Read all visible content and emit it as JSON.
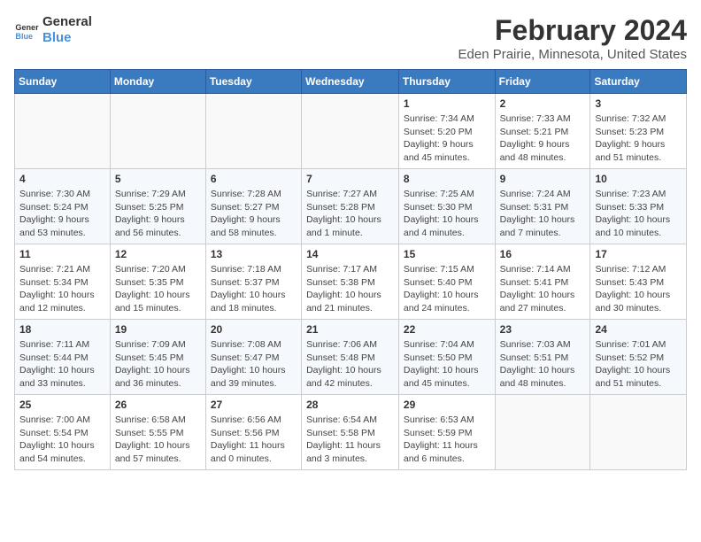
{
  "header": {
    "logo_line1": "General",
    "logo_line2": "Blue",
    "month_title": "February 2024",
    "location": "Eden Prairie, Minnesota, United States"
  },
  "weekdays": [
    "Sunday",
    "Monday",
    "Tuesday",
    "Wednesday",
    "Thursday",
    "Friday",
    "Saturday"
  ],
  "weeks": [
    [
      {
        "day": "",
        "info": ""
      },
      {
        "day": "",
        "info": ""
      },
      {
        "day": "",
        "info": ""
      },
      {
        "day": "",
        "info": ""
      },
      {
        "day": "1",
        "info": "Sunrise: 7:34 AM\nSunset: 5:20 PM\nDaylight: 9 hours\nand 45 minutes."
      },
      {
        "day": "2",
        "info": "Sunrise: 7:33 AM\nSunset: 5:21 PM\nDaylight: 9 hours\nand 48 minutes."
      },
      {
        "day": "3",
        "info": "Sunrise: 7:32 AM\nSunset: 5:23 PM\nDaylight: 9 hours\nand 51 minutes."
      }
    ],
    [
      {
        "day": "4",
        "info": "Sunrise: 7:30 AM\nSunset: 5:24 PM\nDaylight: 9 hours\nand 53 minutes."
      },
      {
        "day": "5",
        "info": "Sunrise: 7:29 AM\nSunset: 5:25 PM\nDaylight: 9 hours\nand 56 minutes."
      },
      {
        "day": "6",
        "info": "Sunrise: 7:28 AM\nSunset: 5:27 PM\nDaylight: 9 hours\nand 58 minutes."
      },
      {
        "day": "7",
        "info": "Sunrise: 7:27 AM\nSunset: 5:28 PM\nDaylight: 10 hours\nand 1 minute."
      },
      {
        "day": "8",
        "info": "Sunrise: 7:25 AM\nSunset: 5:30 PM\nDaylight: 10 hours\nand 4 minutes."
      },
      {
        "day": "9",
        "info": "Sunrise: 7:24 AM\nSunset: 5:31 PM\nDaylight: 10 hours\nand 7 minutes."
      },
      {
        "day": "10",
        "info": "Sunrise: 7:23 AM\nSunset: 5:33 PM\nDaylight: 10 hours\nand 10 minutes."
      }
    ],
    [
      {
        "day": "11",
        "info": "Sunrise: 7:21 AM\nSunset: 5:34 PM\nDaylight: 10 hours\nand 12 minutes."
      },
      {
        "day": "12",
        "info": "Sunrise: 7:20 AM\nSunset: 5:35 PM\nDaylight: 10 hours\nand 15 minutes."
      },
      {
        "day": "13",
        "info": "Sunrise: 7:18 AM\nSunset: 5:37 PM\nDaylight: 10 hours\nand 18 minutes."
      },
      {
        "day": "14",
        "info": "Sunrise: 7:17 AM\nSunset: 5:38 PM\nDaylight: 10 hours\nand 21 minutes."
      },
      {
        "day": "15",
        "info": "Sunrise: 7:15 AM\nSunset: 5:40 PM\nDaylight: 10 hours\nand 24 minutes."
      },
      {
        "day": "16",
        "info": "Sunrise: 7:14 AM\nSunset: 5:41 PM\nDaylight: 10 hours\nand 27 minutes."
      },
      {
        "day": "17",
        "info": "Sunrise: 7:12 AM\nSunset: 5:43 PM\nDaylight: 10 hours\nand 30 minutes."
      }
    ],
    [
      {
        "day": "18",
        "info": "Sunrise: 7:11 AM\nSunset: 5:44 PM\nDaylight: 10 hours\nand 33 minutes."
      },
      {
        "day": "19",
        "info": "Sunrise: 7:09 AM\nSunset: 5:45 PM\nDaylight: 10 hours\nand 36 minutes."
      },
      {
        "day": "20",
        "info": "Sunrise: 7:08 AM\nSunset: 5:47 PM\nDaylight: 10 hours\nand 39 minutes."
      },
      {
        "day": "21",
        "info": "Sunrise: 7:06 AM\nSunset: 5:48 PM\nDaylight: 10 hours\nand 42 minutes."
      },
      {
        "day": "22",
        "info": "Sunrise: 7:04 AM\nSunset: 5:50 PM\nDaylight: 10 hours\nand 45 minutes."
      },
      {
        "day": "23",
        "info": "Sunrise: 7:03 AM\nSunset: 5:51 PM\nDaylight: 10 hours\nand 48 minutes."
      },
      {
        "day": "24",
        "info": "Sunrise: 7:01 AM\nSunset: 5:52 PM\nDaylight: 10 hours\nand 51 minutes."
      }
    ],
    [
      {
        "day": "25",
        "info": "Sunrise: 7:00 AM\nSunset: 5:54 PM\nDaylight: 10 hours\nand 54 minutes."
      },
      {
        "day": "26",
        "info": "Sunrise: 6:58 AM\nSunset: 5:55 PM\nDaylight: 10 hours\nand 57 minutes."
      },
      {
        "day": "27",
        "info": "Sunrise: 6:56 AM\nSunset: 5:56 PM\nDaylight: 11 hours\nand 0 minutes."
      },
      {
        "day": "28",
        "info": "Sunrise: 6:54 AM\nSunset: 5:58 PM\nDaylight: 11 hours\nand 3 minutes."
      },
      {
        "day": "29",
        "info": "Sunrise: 6:53 AM\nSunset: 5:59 PM\nDaylight: 11 hours\nand 6 minutes."
      },
      {
        "day": "",
        "info": ""
      },
      {
        "day": "",
        "info": ""
      }
    ]
  ]
}
